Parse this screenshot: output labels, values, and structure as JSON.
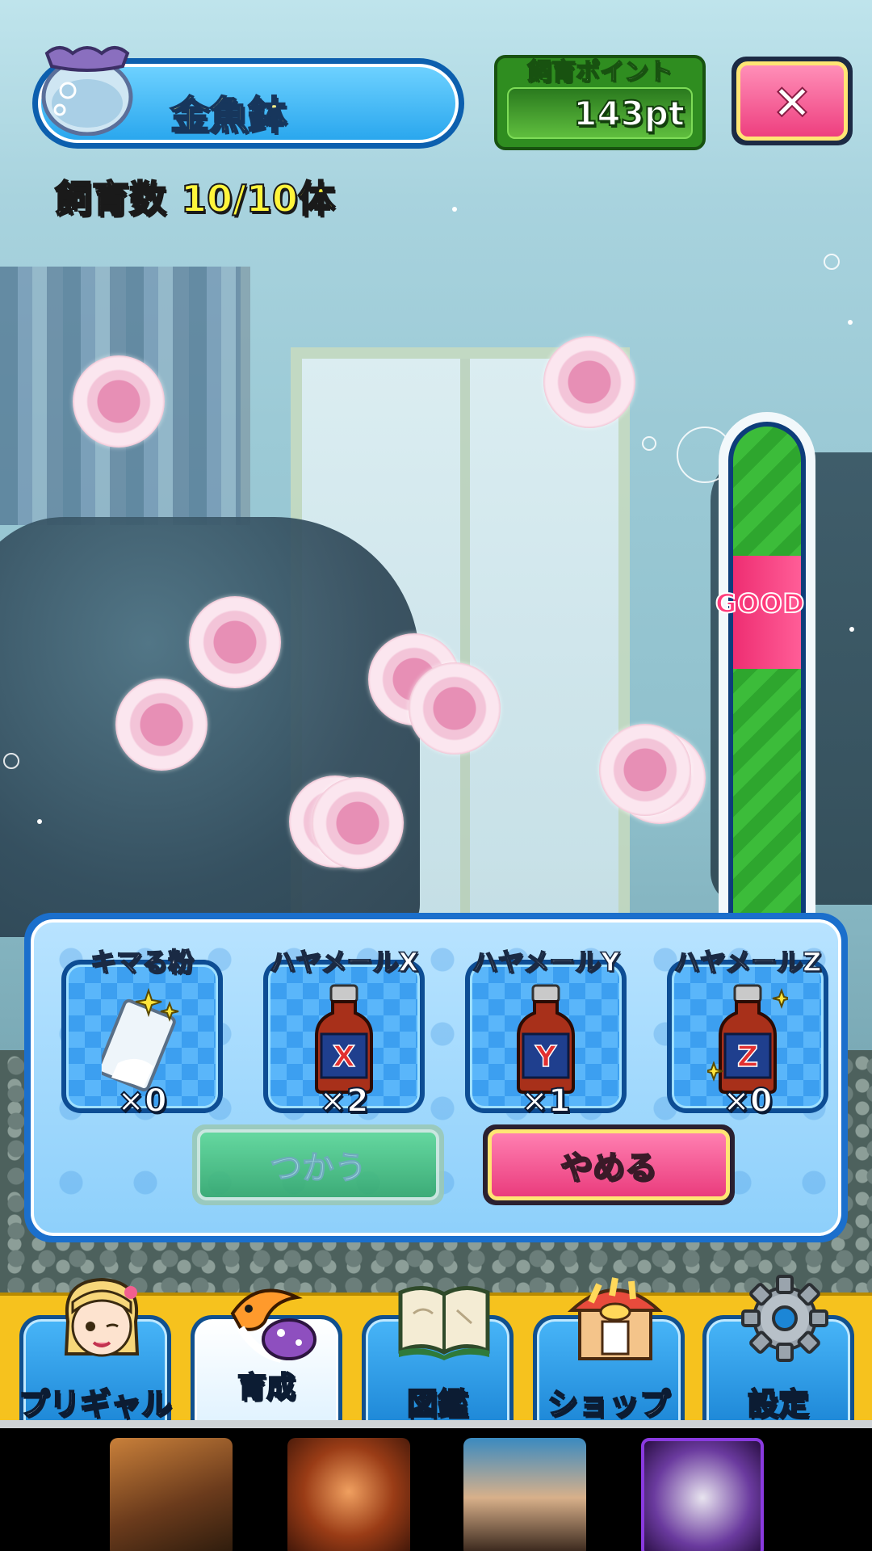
{
  "header": {
    "tank_name": "金魚鉢",
    "points_caption": "飼育ポイント",
    "points_value": "143pt",
    "close_glyph": "×"
  },
  "breeding": {
    "label": "飼育数",
    "count": "10/10体"
  },
  "gauge": {
    "good_label": "GOOD",
    "colors": {
      "track": "#3cbc3a",
      "good_zone": "#ee2e72",
      "frame": "#0d3d7a"
    }
  },
  "items": [
    {
      "name": "キマる粉",
      "count": "×0",
      "icon": "powder-bag-icon"
    },
    {
      "name": "ハヤメールX",
      "count": "×2",
      "icon": "bottle-x-icon",
      "letter": "X"
    },
    {
      "name": "ハヤメールY",
      "count": "×1",
      "icon": "bottle-y-icon",
      "letter": "Y"
    },
    {
      "name": "ハヤメールZ",
      "count": "×0",
      "icon": "bottle-z-icon",
      "letter": "Z"
    }
  ],
  "actions": {
    "use_label": "つかう",
    "cancel_label": "やめる"
  },
  "nav": [
    {
      "label": "プリギャル",
      "icon": "gal-avatar-icon"
    },
    {
      "label": "育成",
      "icon": "fish-breeding-icon",
      "active": true
    },
    {
      "label": "図鑑",
      "icon": "open-book-icon"
    },
    {
      "label": "ショップ",
      "icon": "shop-stall-icon"
    },
    {
      "label": "設定",
      "icon": "gear-icon"
    }
  ],
  "ads": [
    {
      "icon": "soldier-sniper-thumbnail"
    },
    {
      "icon": "warrior-shout-thumbnail"
    },
    {
      "icon": "egyptian-girl-thumbnail"
    },
    {
      "icon": "dark-hair-character-thumbnail"
    }
  ],
  "colors": {
    "accent_blue": "#2aa7ee",
    "accent_pink": "#ee3f7f",
    "points_green": "#2f8d20",
    "nav_yellow": "#f6c21e",
    "count_yellow": "#fff53b"
  }
}
